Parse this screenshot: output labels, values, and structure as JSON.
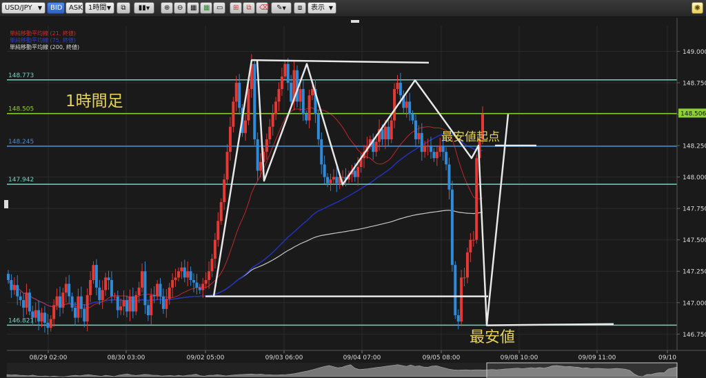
{
  "toolbar": {
    "symbol": "USD/JPY",
    "bid_label": "BID",
    "ask_label": "ASK",
    "timeframe": "1時間",
    "display_label": "表示"
  },
  "legend": [
    {
      "text": "単純移動平均線 (21, 終値)",
      "color": "#d22b2b"
    },
    {
      "text": "単純移動平均線 (75, 終値)",
      "color": "#2e3fcf"
    },
    {
      "text": "単純移動平均線 (200, 終値)",
      "color": "#dddddd"
    }
  ],
  "annotations": {
    "title": "1時間足",
    "lowest_start": "最安値起点",
    "lowest": "最安値"
  },
  "colors": {
    "up": "#e53935",
    "down": "#2f8ad8",
    "ma21": "#c0272d",
    "ma75": "#2233bb",
    "ma200": "#c8c8c8",
    "teal": "#6fd6c6",
    "green": "#8ed13a",
    "blue": "#3f8fe0",
    "annot": "#e6d35b"
  },
  "chart_data": {
    "type": "candlestick",
    "symbol": "USD/JPY",
    "timeframe": "1時間",
    "ylim": [
      146.62,
      149.2
    ],
    "y_ticks": [
      "149.000",
      "148.750",
      "148.500",
      "148.250",
      "148.000",
      "147.750",
      "147.500",
      "147.250",
      "147.000",
      "146.750"
    ],
    "y_tick_values": [
      149.0,
      148.75,
      148.5,
      148.25,
      148.0,
      147.75,
      147.5,
      147.25,
      147.0,
      146.75
    ],
    "x_ticks": [
      "08/29 02:00",
      "08/30 03:00",
      "09/02 05:00",
      "09/03 06:00",
      "09/04 07:00",
      "09/05 08:00",
      "09/08 10:00",
      "09/09 11:00",
      "09/10"
    ],
    "current_price": "148.506",
    "levels": [
      {
        "label": "148.773",
        "value": 148.773,
        "color": "#6fd6c6"
      },
      {
        "label": "148.505",
        "value": 148.505,
        "color": "#8ed13a"
      },
      {
        "label": "148.245",
        "value": 148.245,
        "color": "#3f8fe0"
      },
      {
        "label": "147.942",
        "value": 147.942,
        "color": "#6fd6c6"
      },
      {
        "label": "146.821",
        "value": 146.821,
        "color": "#6fd6c6"
      }
    ],
    "closes": [
      147.18,
      147.1,
      147.14,
      147.05,
      147.02,
      146.96,
      147.08,
      146.93,
      146.88,
      146.94,
      146.85,
      146.92,
      146.84,
      146.8,
      146.87,
      146.98,
      147.05,
      146.96,
      147.08,
      147.15,
      147.05,
      146.96,
      146.88,
      147.05,
      146.95,
      146.85,
      147.06,
      147.18,
      147.3,
      147.12,
      147.02,
      147.1,
      147.2,
      147.18,
      147.05,
      147.05,
      146.94,
      146.97,
      147.02,
      146.93,
      147.05,
      146.93,
      147.06,
      147.12,
      147.25,
      146.98,
      146.9,
      147.06,
      147.05,
      147.15,
      147.05,
      146.95,
      147.03,
      147.12,
      147.18,
      147.2,
      147.25,
      147.28,
      147.2,
      147.25,
      147.18,
      147.16,
      147.12,
      147.1,
      147.15,
      147.18,
      147.25,
      147.35,
      147.5,
      147.65,
      147.8,
      147.98,
      148.2,
      148.4,
      148.6,
      148.75,
      148.55,
      148.35,
      148.45,
      148.7,
      148.9,
      148.3,
      148.05,
      148.12,
      148.2,
      148.3,
      148.4,
      148.5,
      148.6,
      148.7,
      148.8,
      148.9,
      148.75,
      148.6,
      148.85,
      148.6,
      148.7,
      148.5,
      148.45,
      148.65,
      148.7,
      148.5,
      148.3,
      148.1,
      148.0,
      147.95,
      147.98,
      148.0,
      147.95,
      148.0,
      148.0,
      147.98,
      148.02,
      148.05,
      148.0,
      148.08,
      148.15,
      148.2,
      148.25,
      148.3,
      148.2,
      148.28,
      148.38,
      148.3,
      148.4,
      148.3,
      148.45,
      148.7,
      148.75,
      148.65,
      148.55,
      148.6,
      148.5,
      148.45,
      148.3,
      148.35,
      148.2,
      148.25,
      148.25,
      148.2,
      148.15,
      148.2,
      148.25,
      148.2,
      148.1,
      147.9,
      147.3,
      146.9,
      146.85,
      147.2,
      147.2,
      147.4,
      147.5,
      147.5,
      148.15,
      148.3,
      148.5
    ]
  }
}
